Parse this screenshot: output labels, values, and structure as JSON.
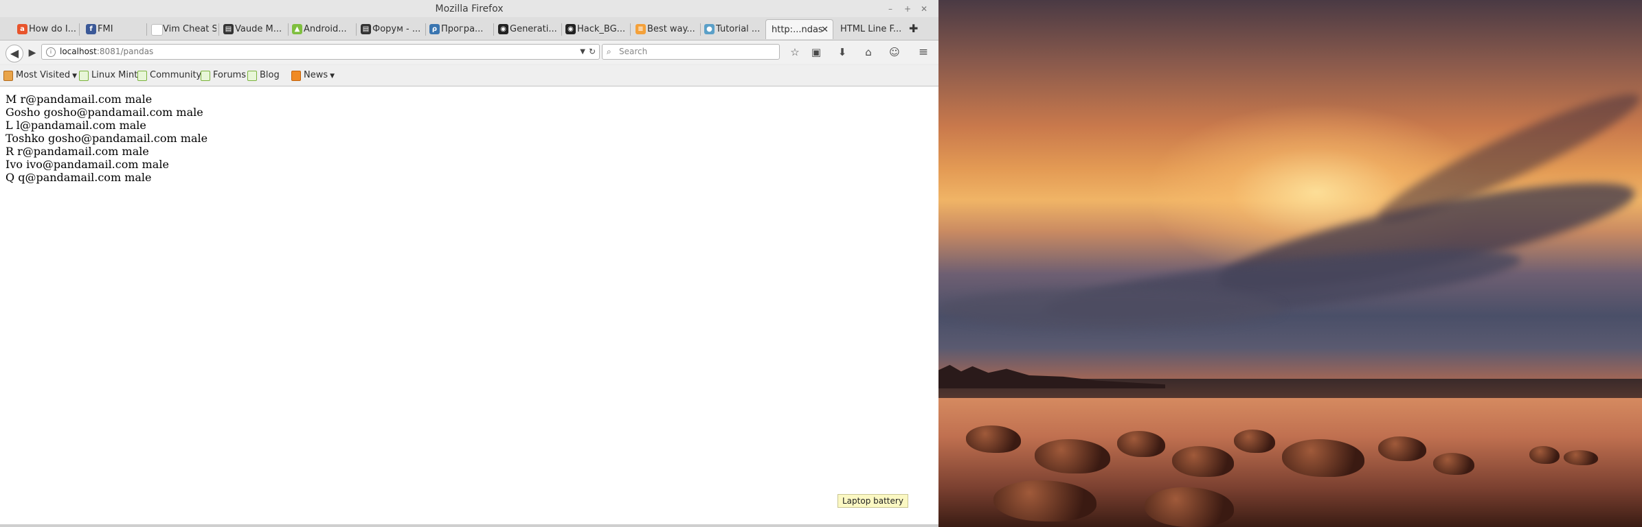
{
  "window": {
    "title": "Mozilla Firefox"
  },
  "tabs": [
    {
      "label": "How do I...",
      "icon": "ask-icon",
      "color": "#e8542c",
      "glyph": "a"
    },
    {
      "label": "FMI",
      "icon": "facebook-icon",
      "color": "#3b5998",
      "glyph": "f"
    },
    {
      "label": "Vim Cheat S...",
      "icon": "blank-page-icon",
      "color": "#ffffff",
      "glyph": ""
    },
    {
      "label": "Vaude M...",
      "icon": "clapper-icon",
      "color": "#333333",
      "glyph": "▤"
    },
    {
      "label": "Android...",
      "icon": "android-icon",
      "color": "#7fbf3f",
      "glyph": "▲"
    },
    {
      "label": "Форум - ...",
      "icon": "clapper-icon",
      "color": "#333333",
      "glyph": "▤"
    },
    {
      "label": "Програ...",
      "icon": "python-icon",
      "color": "#3a75b0",
      "glyph": "ρ"
    },
    {
      "label": "Generati...",
      "icon": "github-icon",
      "color": "#222222",
      "glyph": "◉"
    },
    {
      "label": "Hack_BG...",
      "icon": "github-icon",
      "color": "#222222",
      "glyph": "◉"
    },
    {
      "label": "Best way...",
      "icon": "stack-icon",
      "color": "#f4a13a",
      "glyph": "≡"
    },
    {
      "label": "Tutorial ...",
      "icon": "tutorial-icon",
      "color": "#5ba0c8",
      "glyph": "●"
    },
    {
      "label": "http:...ndas",
      "icon": "",
      "color": "",
      "glyph": "",
      "active": true
    },
    {
      "label": "HTML Line F...",
      "icon": "",
      "color": "",
      "glyph": ""
    }
  ],
  "url": {
    "host": "localhost",
    "rest": ":8081/pandas"
  },
  "search": {
    "placeholder": "Search"
  },
  "bookmarks": [
    {
      "label": "Most Visited",
      "icon": "folder-icon",
      "dropdown": true
    },
    {
      "label": "Linux Mint",
      "icon": "page-icon"
    },
    {
      "label": "Community",
      "icon": "page-icon"
    },
    {
      "label": "Forums",
      "icon": "page-icon"
    },
    {
      "label": "Blog",
      "icon": "page-icon"
    },
    {
      "label": "News",
      "icon": "rss-icon",
      "dropdown": true
    }
  ],
  "pandas": [
    "M r@pandamail.com male",
    "Gosho gosho@pandamail.com male",
    "L l@pandamail.com male",
    "Toshko gosho@pandamail.com male",
    "R r@pandamail.com male",
    "Ivo ivo@pandamail.com male",
    "Q q@pandamail.com male"
  ],
  "tooltip": "Laptop battery"
}
